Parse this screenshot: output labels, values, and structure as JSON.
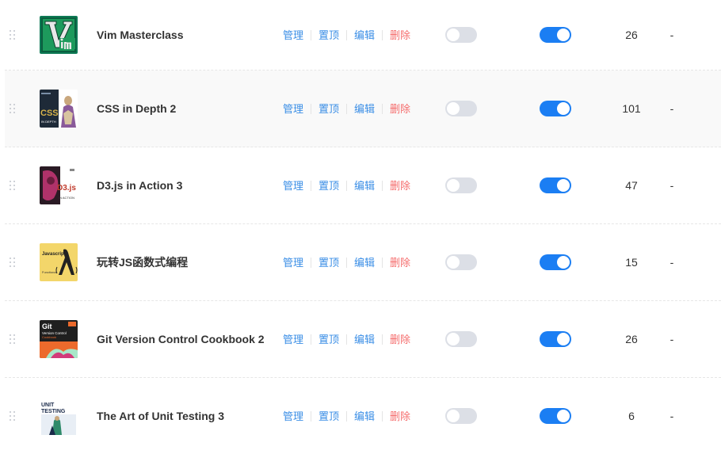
{
  "action_labels": {
    "manage": "管理",
    "pin": "置顶",
    "edit": "编辑",
    "delete": "删除"
  },
  "colors": {
    "accent": "#1b7ef3",
    "link": "#3a8ee6",
    "danger": "#f56c6c",
    "switch_off": "#dcdfe6"
  },
  "rows": [
    {
      "title": "Vim Masterclass",
      "cover": {
        "icon": "vim-logo",
        "text": "Vim"
      },
      "switch1": false,
      "switch2": true,
      "count": "26",
      "extra": "-"
    },
    {
      "title": "CSS in Depth 2",
      "cover": {
        "icon": "book-cover-css-in-depth",
        "text": "CSS IN DEPTH"
      },
      "switch1": false,
      "switch2": true,
      "count": "101",
      "extra": "-"
    },
    {
      "title": "D3.js in Action 3",
      "cover": {
        "icon": "book-cover-d3js",
        "text": "D3.js IN ACTION"
      },
      "switch1": false,
      "switch2": true,
      "count": "47",
      "extra": "-"
    },
    {
      "title": "玩转JS函数式编程",
      "cover": {
        "icon": "book-cover-javascript-functional",
        "text": "Javascript Functional"
      },
      "switch1": false,
      "switch2": true,
      "count": "15",
      "extra": "-"
    },
    {
      "title": "Git Version Control Cookbook 2",
      "cover": {
        "icon": "book-cover-git-cookbook",
        "text": "Git Version Control Cookbook"
      },
      "switch1": false,
      "switch2": true,
      "count": "26",
      "extra": "-"
    },
    {
      "title": "The Art of Unit Testing 3",
      "cover": {
        "icon": "book-cover-unit-testing",
        "text": "UNIT TESTING"
      },
      "switch1": false,
      "switch2": true,
      "count": "6",
      "extra": "-"
    }
  ]
}
